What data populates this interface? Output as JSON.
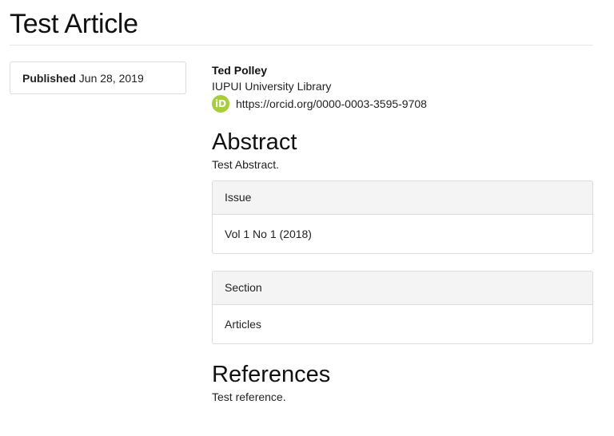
{
  "article": {
    "title": "Test Article"
  },
  "published": {
    "label": "Published",
    "date": "Jun 28, 2019"
  },
  "author": {
    "name": "Ted Polley",
    "affiliation": "IUPUI University Library",
    "orcid_icon_text": "iD",
    "orcid_url": "https://orcid.org/0000-0003-3595-9708",
    "orcid_icon": "orcid-icon"
  },
  "abstract": {
    "heading": "Abstract",
    "text": "Test Abstract."
  },
  "issue": {
    "heading": "Issue",
    "value": "Vol 1 No 1 (2018)"
  },
  "section": {
    "heading": "Section",
    "value": "Articles"
  },
  "references": {
    "heading": "References",
    "text": "Test reference."
  },
  "colors": {
    "orcid_green": "#a6ce39",
    "panel_header_bg": "#f4f4f4",
    "border": "#dcdcdc"
  }
}
